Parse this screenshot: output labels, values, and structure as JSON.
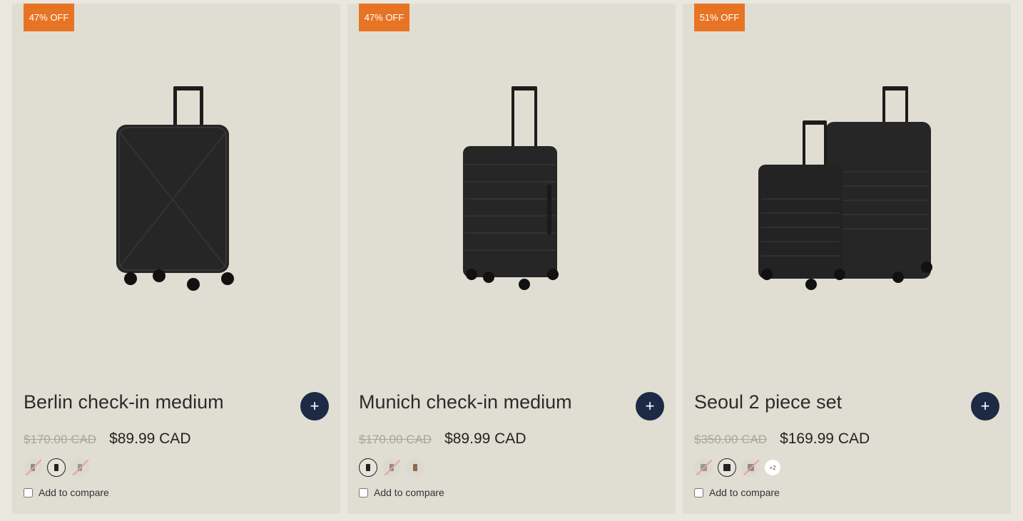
{
  "products": [
    {
      "badge": "47% OFF",
      "title": "Berlin check-in medium",
      "old_price": "$170.00 CAD",
      "price": "$89.99 CAD",
      "swatches": [
        {
          "color": "#8f8c86",
          "selected": false,
          "unavailable": true
        },
        {
          "color": "#222222",
          "selected": true,
          "unavailable": false
        },
        {
          "color": "#9a9690",
          "selected": false,
          "unavailable": true
        }
      ],
      "compare_label": "Add to compare"
    },
    {
      "badge": "47% OFF",
      "title": "Munich check-in medium",
      "old_price": "$170.00 CAD",
      "price": "$89.99 CAD",
      "swatches": [
        {
          "color": "#222222",
          "selected": true,
          "unavailable": false
        },
        {
          "color": "#8f8c86",
          "selected": false,
          "unavailable": true
        },
        {
          "color": "#8b6a4e",
          "selected": false,
          "unavailable": false
        }
      ],
      "compare_label": "Add to compare"
    },
    {
      "badge": "51% OFF",
      "title": "Seoul 2 piece set",
      "old_price": "$350.00 CAD",
      "price": "$169.99 CAD",
      "swatches": [
        {
          "color": "#9a9690",
          "selected": false,
          "unavailable": true
        },
        {
          "color": "#222222",
          "selected": true,
          "unavailable": false
        },
        {
          "color": "#8f8c86",
          "selected": false,
          "unavailable": true
        }
      ],
      "more_swatches": "+2",
      "compare_label": "Add to compare"
    }
  ],
  "colors": {
    "badge": "#e77424",
    "add_button": "#1d2a44",
    "card_bg": "#e0ded3"
  }
}
